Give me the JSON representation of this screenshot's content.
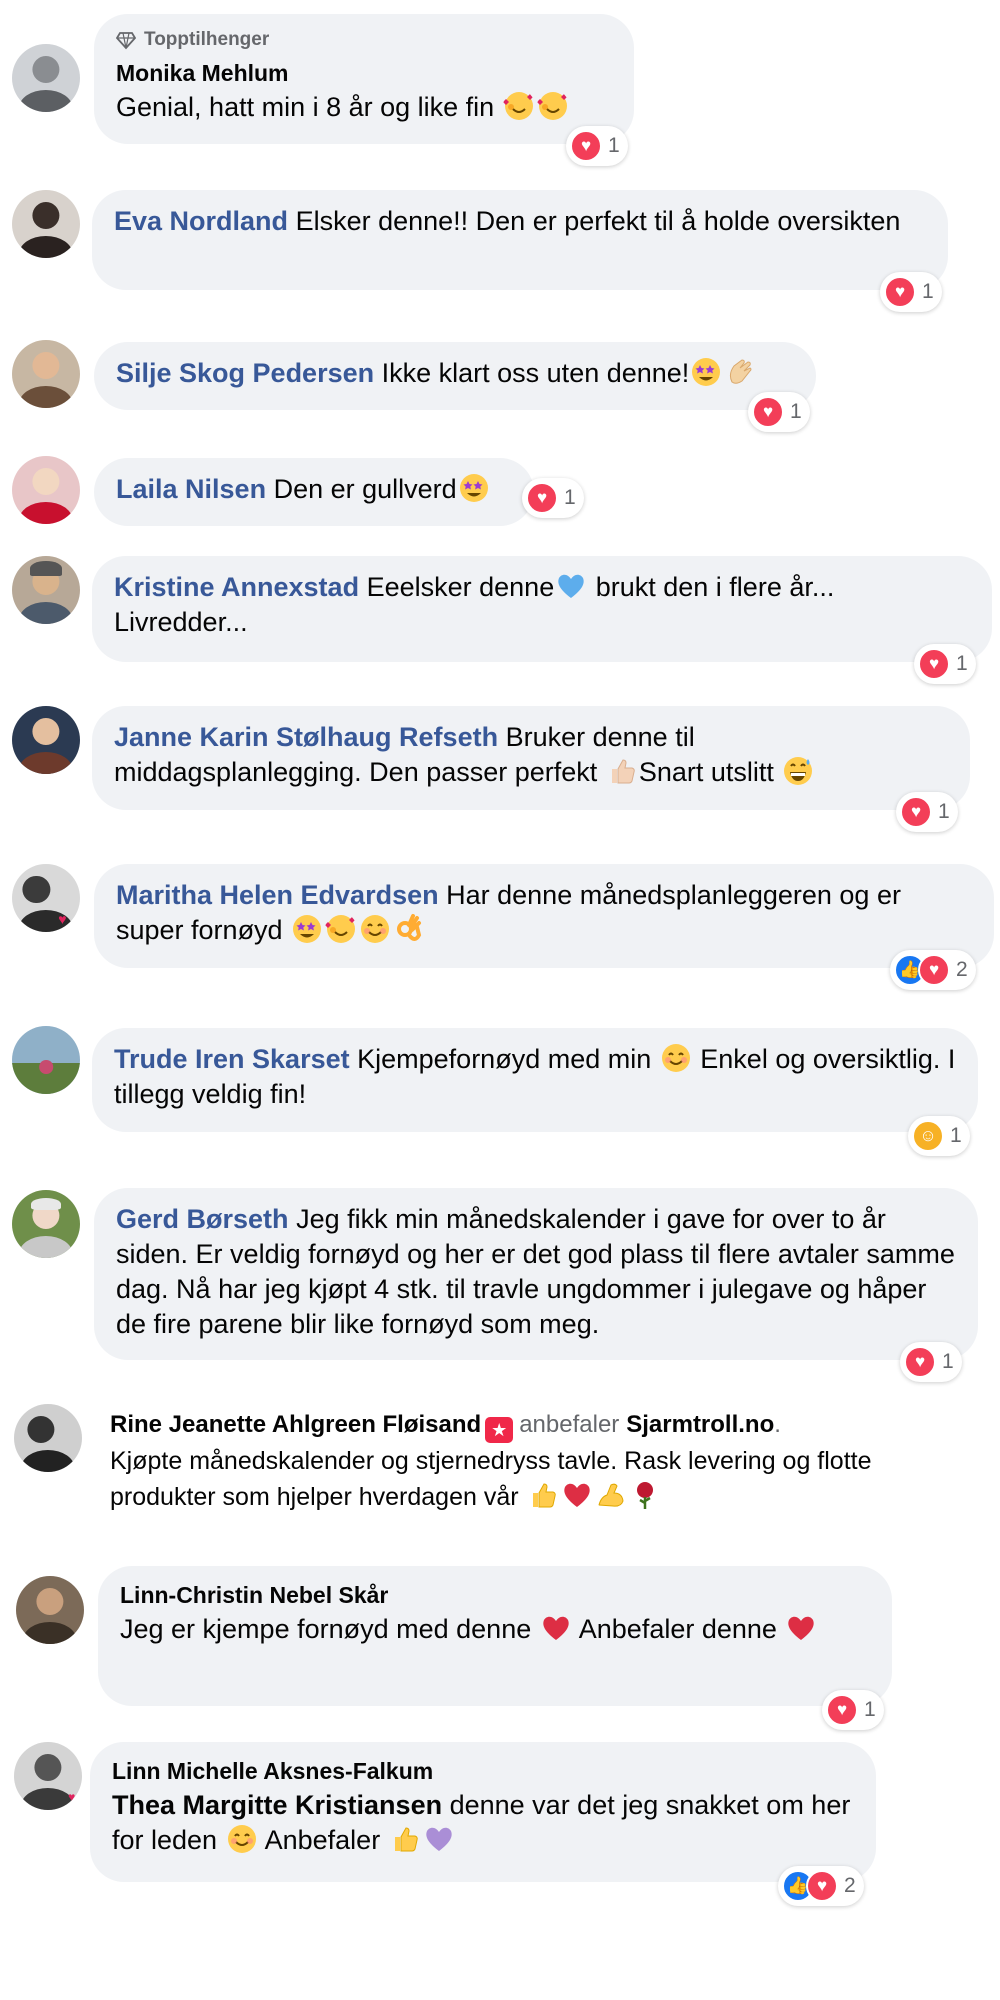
{
  "comments": [
    {
      "author": "Monika Mehlum",
      "badge": "Topptilhenger",
      "text": "Genial, hatt min i 8 år og like fin",
      "emoji_after": [
        "smiling-face-hearts",
        "smiling-face-hearts"
      ],
      "reactions": [
        "love"
      ],
      "reaction_count": "1"
    },
    {
      "author": "Eva Nordland",
      "text": "Elsker denne!! Den er perfekt til å holde oversikten",
      "reactions": [
        "love"
      ],
      "reaction_count": "1"
    },
    {
      "author": "Silje Skog Pedersen",
      "text": "Ikke klart oss uten denne!",
      "emoji_after": [
        "star-struck",
        "clapping-hands"
      ],
      "reactions": [
        "love"
      ],
      "reaction_count": "1"
    },
    {
      "author": "Laila Nilsen",
      "text": "Den er gullverd",
      "emoji_after": [
        "star-struck"
      ],
      "reactions": [
        "love"
      ],
      "reaction_count": "1"
    },
    {
      "author": "Kristine Annexstad",
      "text_a": "Eeelsker denne",
      "text_b": "brukt den i flere år... Livredder...",
      "emoji_mid": [
        "blue-heart"
      ],
      "reactions": [
        "love"
      ],
      "reaction_count": "1"
    },
    {
      "author": "Janne Karin Stølhaug Refseth",
      "text_a": "Bruker denne til middagsplanlegging. Den passer perfekt",
      "text_b": "Snart utslitt",
      "emoji_mid": [
        "thumbs-up-light"
      ],
      "emoji_after": [
        "grinning-sweat"
      ],
      "reactions": [
        "love"
      ],
      "reaction_count": "1"
    },
    {
      "author": "Maritha Helen Edvardsen",
      "text": "Har denne månedsplanleggeren og er super fornøyd",
      "emoji_after": [
        "star-struck",
        "smiling-face-hearts",
        "smiling-face",
        "ok-hand"
      ],
      "reactions": [
        "like",
        "love"
      ],
      "reaction_count": "2"
    },
    {
      "author": "Trude Iren Skarset",
      "text_a": "Kjempefornøyd med min",
      "text_b": "Enkel og oversiktlig. I tillegg veldig fin!",
      "emoji_mid": [
        "smiling-face"
      ],
      "reactions": [
        "care"
      ],
      "reaction_count": "1"
    },
    {
      "author": "Gerd Børseth",
      "text": "Jeg fikk min månedskalender i gave for over to år siden. Er veldig fornøyd og her er det god plass til flere avtaler samme dag. Nå har jeg kjøpt 4 stk. til travle ungdommer i julegave og håper de fire parene blir like fornøyd som meg.",
      "reactions": [
        "love"
      ],
      "reaction_count": "1"
    },
    {
      "author": "Rine Jeanette Ahlgreen Fløisand",
      "recommends_label": "anbefaler",
      "page": "Sjarmtroll.no",
      "page_suffix": ".",
      "text": "Kjøpte månedskalender og stjernedryss tavle. Rask levering og flotte produkter som hjelper hverdagen vår",
      "emoji_after": [
        "thumbs-up",
        "red-heart",
        "flexed-biceps",
        "rose"
      ]
    },
    {
      "author": "Linn-Christin Nebel Skår",
      "text_a": "Jeg er kjempe fornøyd med denne",
      "text_b": "Anbefaler denne",
      "emoji_mid": [
        "red-heart"
      ],
      "emoji_after": [
        "red-heart"
      ],
      "reactions": [
        "love"
      ],
      "reaction_count": "1"
    },
    {
      "author": "Linn Michelle Aksnes-Falkum",
      "tagged": "Thea Margitte Kristiansen",
      "text_a": "denne var det jeg snakket om her for leden",
      "text_b": "Anbefaler",
      "emoji_mid": [
        "smiling-face"
      ],
      "emoji_after": [
        "thumbs-up",
        "purple-heart"
      ],
      "reactions": [
        "like",
        "love"
      ],
      "reaction_count": "2"
    }
  ],
  "colors": {
    "author_link": "#385898",
    "bubble_bg": "#f0f2f5",
    "love": "#f33e58",
    "like": "#1877f2"
  }
}
